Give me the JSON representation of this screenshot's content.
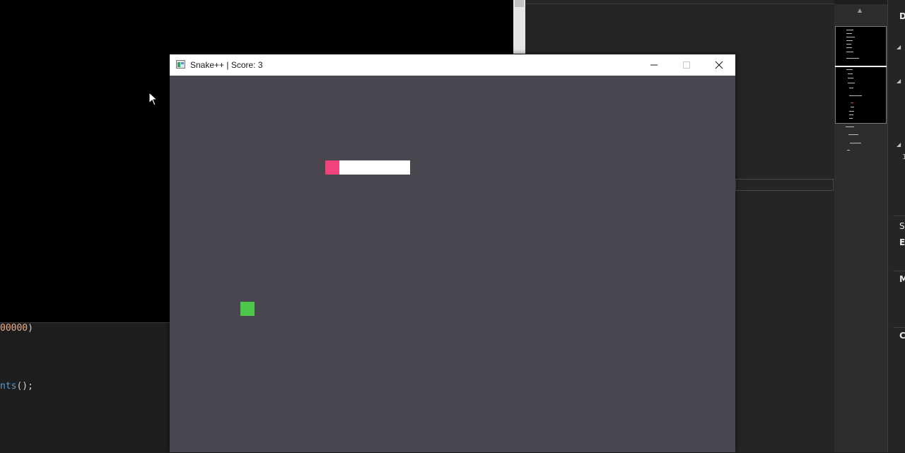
{
  "window": {
    "title": "Snake++ | Score: 3",
    "app_icon": "app-window-icon",
    "controls": [
      "minimize-icon",
      "maximize-icon",
      "close-icon"
    ]
  },
  "game": {
    "score": 3,
    "board_color": "#4a4650",
    "snake_head_color": "#f0427b",
    "snake_body_color": "#ffffff",
    "food_color": "#4dc84d",
    "snake_segment_count": 6
  },
  "background_editor": {
    "lines": [
      {
        "text_num": "00000",
        "text_punct": ")"
      },
      {
        "text_fn": "nts",
        "text_punct": "();"
      }
    ]
  },
  "right_panel": {
    "letters": [
      "D",
      "S",
      "E",
      "M",
      "C"
    ],
    "mini_text": [
      "1"
    ]
  }
}
